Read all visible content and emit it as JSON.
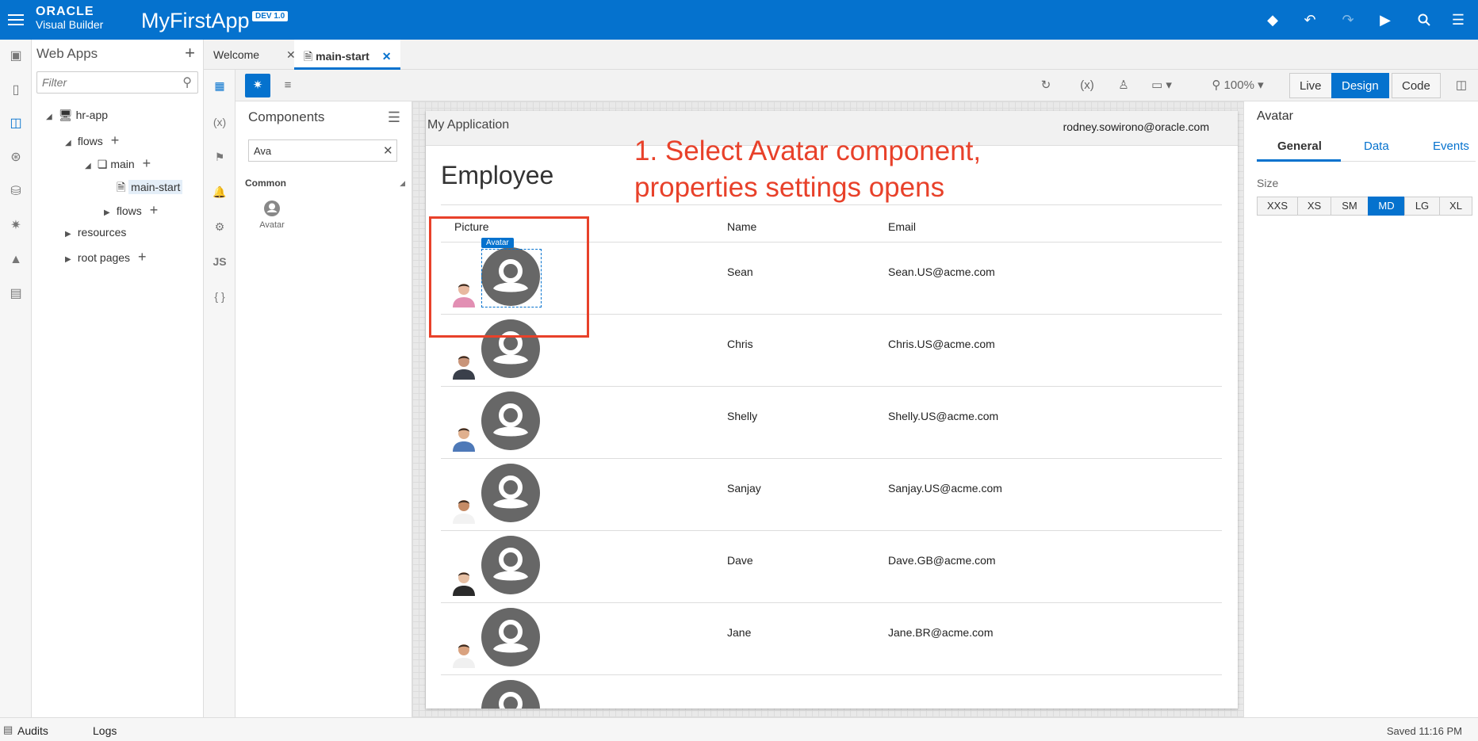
{
  "header": {
    "brand_top": "ORACLE",
    "brand_bottom": "Visual Builder",
    "app_name": "MyFirstApp",
    "badge": "DEV 1.0"
  },
  "webapps": {
    "title": "Web Apps",
    "filter_placeholder": "Filter",
    "tree": {
      "app": "hr-app",
      "flows": "flows",
      "main": "main",
      "main_start": "main-start",
      "sub_flows": "flows",
      "resources": "resources",
      "root_pages": "root pages"
    }
  },
  "tabs": [
    {
      "label": "Welcome"
    },
    {
      "label": "main-start"
    }
  ],
  "toolbar": {
    "zoom": "100%",
    "modes": [
      "Live",
      "Design",
      "Code"
    ],
    "active_mode": "Design"
  },
  "components": {
    "title": "Components",
    "search_value": "Ava",
    "category": "Common",
    "item": "Avatar"
  },
  "page": {
    "app_title": "My Application",
    "user": "rodney.sowirono@oracle.com",
    "heading": "Employee",
    "columns": [
      "Picture",
      "Name",
      "Email"
    ],
    "rows": [
      {
        "name": "Sean",
        "email": "Sean.US@acme.com"
      },
      {
        "name": "Chris",
        "email": "Chris.US@acme.com"
      },
      {
        "name": "Shelly",
        "email": "Shelly.US@acme.com"
      },
      {
        "name": "Sanjay",
        "email": "Sanjay.US@acme.com"
      },
      {
        "name": "Dave",
        "email": "Dave.GB@acme.com"
      },
      {
        "name": "Jane",
        "email": "Jane.BR@acme.com"
      }
    ],
    "selected_tag": "Avatar"
  },
  "annotation": {
    "line1": "1. Select Avatar component,",
    "line2": "properties settings opens"
  },
  "properties": {
    "title": "Avatar",
    "tabs": [
      "General",
      "Data",
      "Events"
    ],
    "size_label": "Size",
    "sizes": [
      "XXS",
      "XS",
      "SM",
      "MD",
      "LG",
      "XL"
    ],
    "active_size": "MD"
  },
  "status": {
    "audits": "Audits",
    "logs": "Logs",
    "saved": "Saved 11:16 PM"
  },
  "colors": {
    "brand": "#0572ce",
    "annotation": "#e8412a"
  }
}
